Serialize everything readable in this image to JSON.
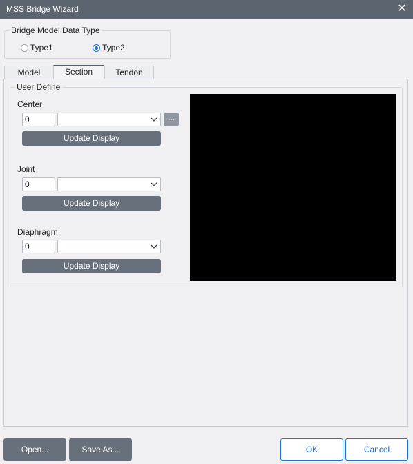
{
  "window": {
    "title": "MSS Bridge Wizard"
  },
  "model_type": {
    "legend": "Bridge Model Data Type",
    "options": [
      {
        "label": "Type1",
        "checked": false
      },
      {
        "label": "Type2",
        "checked": true
      }
    ]
  },
  "tabs": [
    {
      "label": "Model",
      "active": false
    },
    {
      "label": "Section",
      "active": true
    },
    {
      "label": "Tendon",
      "active": false
    }
  ],
  "user_define": {
    "legend": "User Define",
    "center": {
      "label": "Center",
      "value": "0",
      "selected": "",
      "browse_label": "...",
      "update_label": "Update Display"
    },
    "joint": {
      "label": "Joint",
      "value": "0",
      "selected": "",
      "update_label": "Update Display"
    },
    "diaphragm": {
      "label": "Diaphragm",
      "value": "0",
      "selected": "",
      "update_label": "Update Display"
    }
  },
  "footer": {
    "open_label": "Open...",
    "save_as_label": "Save As...",
    "ok_label": "OK",
    "cancel_label": "Cancel"
  }
}
